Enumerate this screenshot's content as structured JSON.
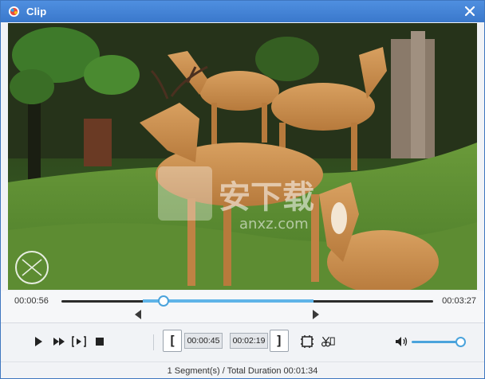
{
  "window": {
    "title": "Clip",
    "accent": "#3a78cb"
  },
  "icons": {
    "app": "app-logo-icon",
    "close": "close-icon",
    "play": "play-icon",
    "fast_forward": "fast-forward-icon",
    "step": "frame-step-icon",
    "stop": "stop-icon",
    "set_start": "set-start-bracket-icon",
    "set_end": "set-end-bracket-icon",
    "add_segment": "add-segment-icon",
    "split": "scissors-icon",
    "volume": "speaker-icon"
  },
  "timeline": {
    "current_time": "00:00:56",
    "total_time": "00:03:27"
  },
  "clip": {
    "start_label": "[",
    "end_label": "]",
    "start_time": "00:00:45",
    "end_time": "00:02:19"
  },
  "volume": {
    "level": 0.9
  },
  "status": {
    "summary": "1 Segment(s) / Total Duration 00:01:34"
  },
  "watermark": {
    "text": "安下载",
    "subtext": "anxz.com"
  }
}
